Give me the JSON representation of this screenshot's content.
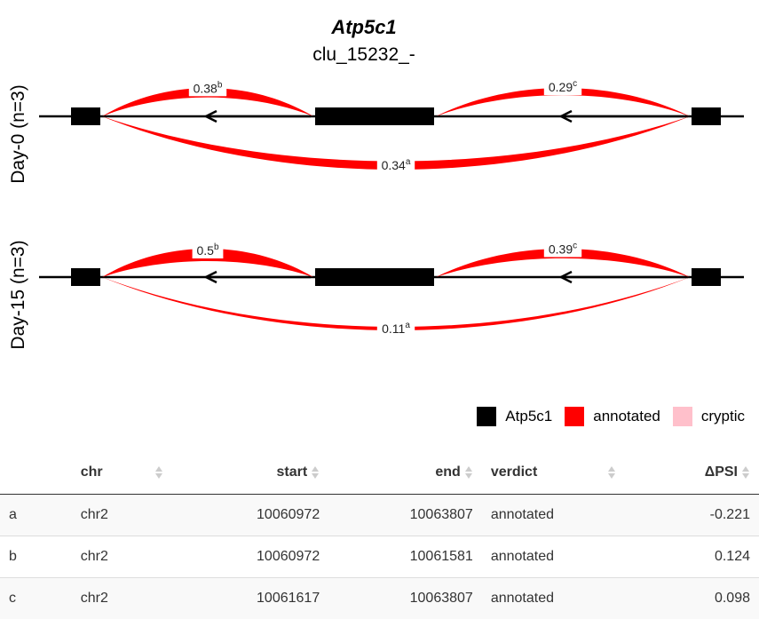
{
  "title": "Atp5c1",
  "subtitle": "clu_15232_-",
  "panels": [
    {
      "label": "Day-0 (n=3)",
      "junctions": [
        {
          "value": "0.38",
          "sup": "b",
          "psi": 0.38,
          "from": "exon1",
          "to": "exon2"
        },
        {
          "value": "0.29",
          "sup": "c",
          "psi": 0.29,
          "from": "exon2",
          "to": "exon3"
        },
        {
          "value": "0.34",
          "sup": "a",
          "psi": 0.34,
          "from": "exon1",
          "to": "exon3"
        }
      ]
    },
    {
      "label": "Day-15 (n=3)",
      "junctions": [
        {
          "value": "0.5",
          "sup": "b",
          "psi": 0.5,
          "from": "exon1",
          "to": "exon2"
        },
        {
          "value": "0.39",
          "sup": "c",
          "psi": 0.39,
          "from": "exon2",
          "to": "exon3"
        },
        {
          "value": "0.11",
          "sup": "a",
          "psi": 0.11,
          "from": "exon1",
          "to": "exon3"
        }
      ]
    }
  ],
  "colors": {
    "gene": "#000000",
    "annotated": "#ff0000",
    "cryptic": "#ffc0cb"
  },
  "legend": [
    {
      "label": "Atp5c1",
      "color": "#000000"
    },
    {
      "label": "annotated",
      "color": "#ff0000"
    },
    {
      "label": "cryptic",
      "color": "#ffc0cb"
    }
  ],
  "table": {
    "headers": [
      {
        "label": "",
        "align": "left",
        "sortable": false
      },
      {
        "label": "chr",
        "align": "left",
        "sortable": true
      },
      {
        "label": "start",
        "align": "right",
        "sortable": true
      },
      {
        "label": "end",
        "align": "right",
        "sortable": true
      },
      {
        "label": "verdict",
        "align": "left",
        "sortable": true
      },
      {
        "label": "ΔPSI",
        "align": "right",
        "sortable": true
      }
    ],
    "rows": [
      [
        "a",
        "chr2",
        "10060972",
        "10063807",
        "annotated",
        "-0.221"
      ],
      [
        "b",
        "chr2",
        "10060972",
        "10061581",
        "annotated",
        "0.124"
      ],
      [
        "c",
        "chr2",
        "10061617",
        "10063807",
        "annotated",
        "0.098"
      ]
    ]
  }
}
